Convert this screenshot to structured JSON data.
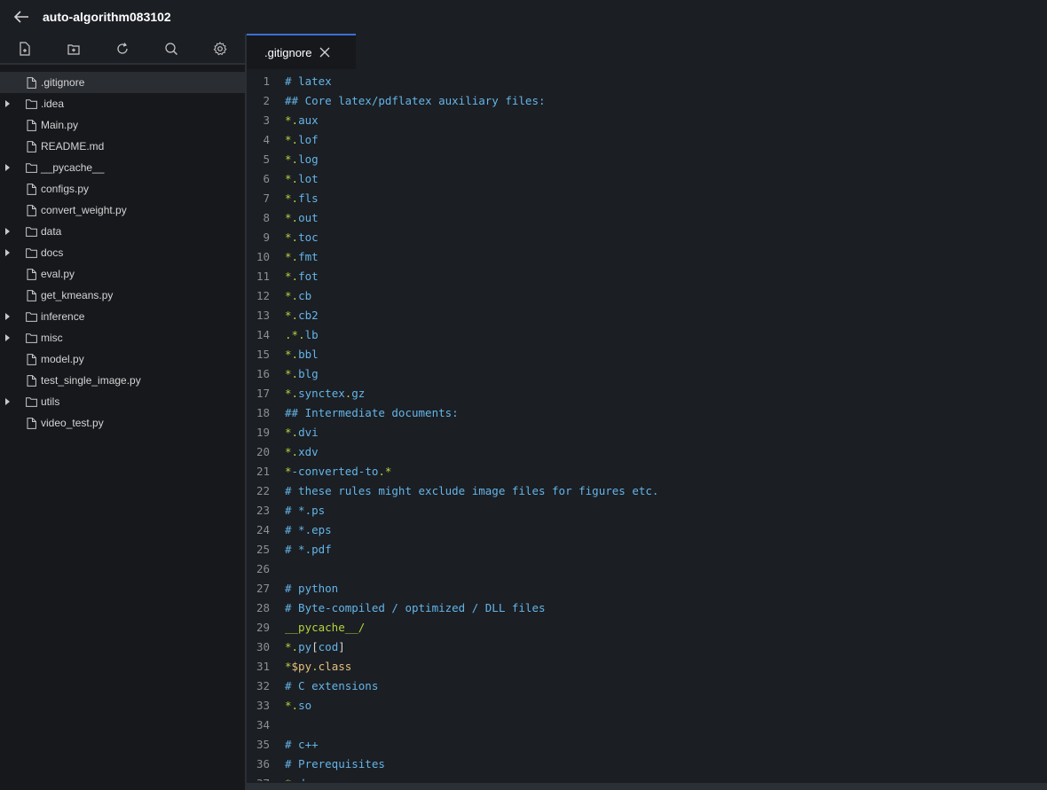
{
  "topbar": {
    "title": "auto-algorithm083102"
  },
  "sidebar": {
    "items": [
      {
        "label": ".gitignore",
        "type": "file",
        "active": true
      },
      {
        "label": ".idea",
        "type": "folder"
      },
      {
        "label": "Main.py",
        "type": "file"
      },
      {
        "label": "README.md",
        "type": "file"
      },
      {
        "label": "__pycache__",
        "type": "folder"
      },
      {
        "label": "configs.py",
        "type": "file"
      },
      {
        "label": "convert_weight.py",
        "type": "file"
      },
      {
        "label": "data",
        "type": "folder"
      },
      {
        "label": "docs",
        "type": "folder"
      },
      {
        "label": "eval.py",
        "type": "file"
      },
      {
        "label": "get_kmeans.py",
        "type": "file"
      },
      {
        "label": "inference",
        "type": "folder"
      },
      {
        "label": "misc",
        "type": "folder"
      },
      {
        "label": "model.py",
        "type": "file"
      },
      {
        "label": "test_single_image.py",
        "type": "file"
      },
      {
        "label": "utils",
        "type": "folder"
      },
      {
        "label": "video_test.py",
        "type": "file"
      }
    ]
  },
  "editor": {
    "tab_label": ".gitignore",
    "lines": [
      "# latex",
      "## Core latex/pdflatex auxiliary files:",
      "*.aux",
      "*.lof",
      "*.log",
      "*.lot",
      "*.fls",
      "*.out",
      "*.toc",
      "*.fmt",
      "*.fot",
      "*.cb",
      "*.cb2",
      ".*.lb",
      "*.bbl",
      "*.blg",
      "*.synctex.gz",
      "## Intermediate documents:",
      "*.dvi",
      "*.xdv",
      "*-converted-to.*",
      "# these rules might exclude image files for figures etc.",
      "# *.ps",
      "# *.eps",
      "# *.pdf",
      "",
      "# python",
      "# Byte-compiled / optimized / DLL files",
      "__pycache__/",
      "*.py[cod]",
      "*$py.class",
      "# C extensions",
      "*.so",
      "",
      "# c++",
      "# Prerequisites",
      "*.d"
    ]
  },
  "colors": {
    "comment": "#64b5e8",
    "symbol": "#b5d33d",
    "variable": "#e6c07b",
    "tab_accent": "#3b6fd6"
  }
}
